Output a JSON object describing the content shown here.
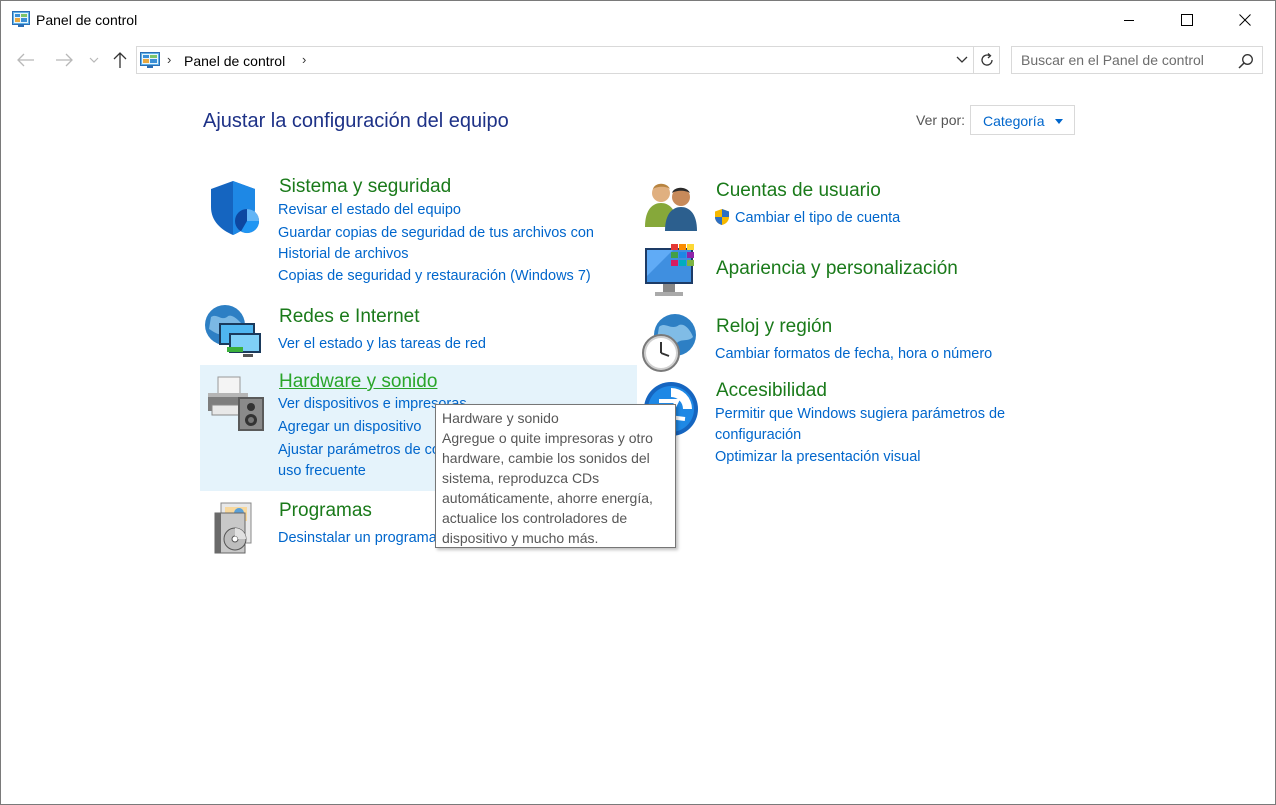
{
  "window": {
    "title": "Panel de control"
  },
  "navigation": {
    "breadcrumb": "Panel de control",
    "search_placeholder": "Buscar en el Panel de control"
  },
  "content": {
    "title": "Ajustar la configuración del equipo",
    "view_by_label": "Ver por:",
    "view_by_value": "Categoría"
  },
  "categories": {
    "system": {
      "title": "Sistema y seguridad",
      "links": [
        "Revisar el estado del equipo",
        "Guardar copias de seguridad de tus archivos con Historial de archivos",
        "Copias de seguridad y restauración (Windows 7)"
      ]
    },
    "network": {
      "title": "Redes e Internet",
      "links": [
        "Ver el estado y las tareas de red"
      ]
    },
    "hardware": {
      "title": "Hardware y sonido",
      "links": [
        "Ver dispositivos e impresoras",
        "Agregar un dispositivo",
        "Ajustar parámetros de configuración de movilidad de uso frecuente"
      ]
    },
    "programs": {
      "title": "Programas",
      "links": [
        "Desinstalar un programa"
      ]
    },
    "accounts": {
      "title": "Cuentas de usuario",
      "links": [
        "Cambiar el tipo de cuenta"
      ]
    },
    "appearance": {
      "title": "Apariencia y personalización"
    },
    "clock": {
      "title": "Reloj y región",
      "links": [
        "Cambiar formatos de fecha, hora o número"
      ]
    },
    "accessibility": {
      "title": "Accesibilidad",
      "links": [
        "Permitir que Windows sugiera parámetros de configuración",
        "Optimizar la presentación visual"
      ]
    }
  },
  "tooltip": {
    "title": "Hardware y sonido",
    "text": "Agregue o quite impresoras y otro hardware, cambie los sonidos del sistema, reproduzca CDs automáticamente, ahorre energía, actualice los controladores de dispositivo y mucho más."
  },
  "colors": {
    "category_title": "#1a7a1a",
    "link": "#0066cc",
    "page_title": "#1e3287",
    "highlight": "#e5f3fb"
  }
}
